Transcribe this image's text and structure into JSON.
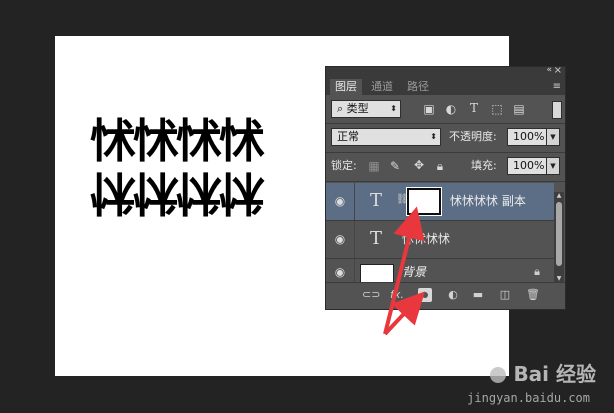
{
  "canvas": {
    "text_top": "怵怵怵怵",
    "text_mirror": "怵怵怵怵",
    "background": "#ffffff"
  },
  "panel": {
    "collapse_icon": "«",
    "close_icon": "×",
    "tabs": [
      {
        "label": "图层",
        "active": true
      },
      {
        "label": "通道",
        "active": false
      },
      {
        "label": "路径",
        "active": false
      }
    ],
    "menu_icon": "≡",
    "filter": {
      "search_icon": "⌕",
      "kind_label": "类型",
      "icons": [
        "image-filter-icon",
        "adjustment-filter-icon",
        "type-filter-icon",
        "shape-filter-icon",
        "smart-object-filter-icon"
      ]
    },
    "blend_mode": "正常",
    "opacity_label": "不透明度:",
    "opacity_value": "100%",
    "lock_label": "锁定:",
    "fill_label": "填充:",
    "fill_value": "100%",
    "layers": [
      {
        "name": "怵怵怵怵 副本",
        "type": "text",
        "has_mask": true,
        "selected": true
      },
      {
        "name": "怵怵怵怵",
        "type": "text",
        "has_mask": false,
        "selected": false
      },
      {
        "name": "背景",
        "type": "background",
        "has_mask": false,
        "selected": false,
        "locked": true
      }
    ],
    "bottom_icons": [
      "link-layers-icon",
      "fx-icon",
      "add-mask-icon",
      "adjustment-layer-icon",
      "new-group-icon",
      "new-layer-icon",
      "trash-icon"
    ],
    "fx_label": "fx."
  },
  "watermark": {
    "brand": "Bai 经验",
    "url": "jingyan.baidu.com"
  },
  "colors": {
    "selected_layer": "#5c6e85",
    "panel_bg": "#535353",
    "arrow": "#e8383d"
  }
}
